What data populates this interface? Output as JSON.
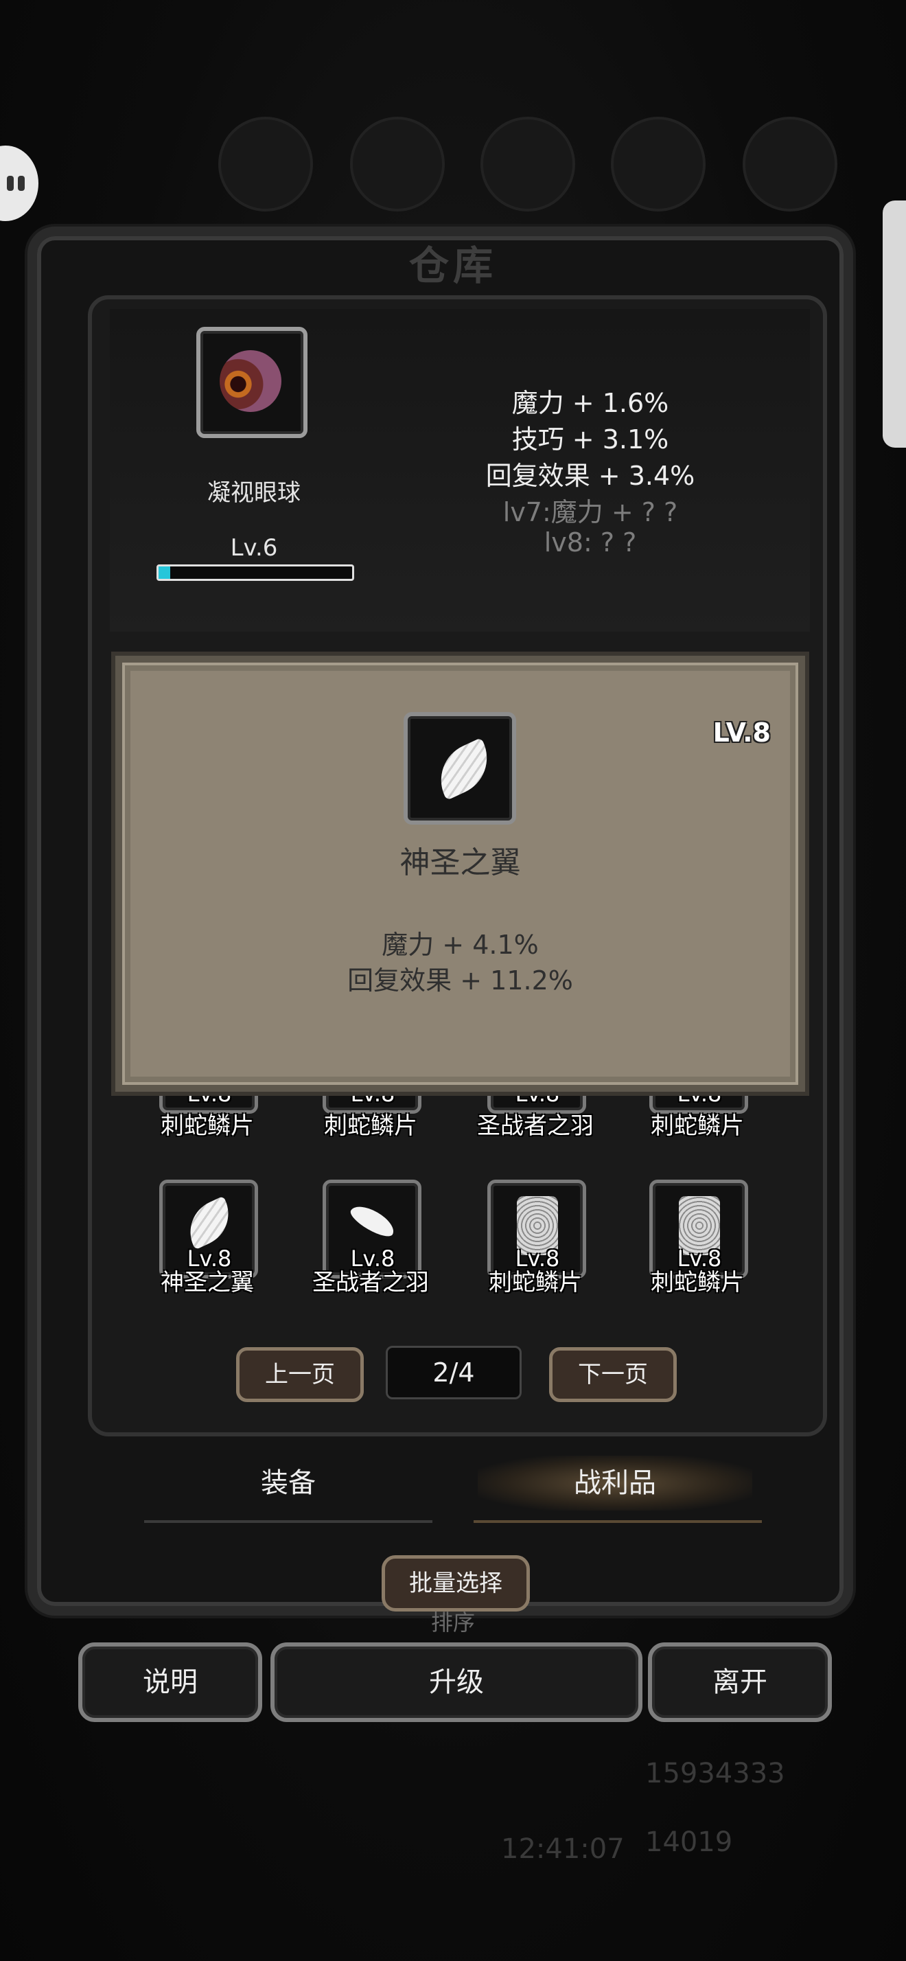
{
  "title": "仓库",
  "selected_item": {
    "name": "凝视眼球",
    "level": "Lv.6",
    "progress": 0.06,
    "stats": [
      "魔力 + 1.6%",
      "技巧 + 3.1%",
      "回复效果 + 3.4%"
    ],
    "locked_stats": [
      "lv7:魔力 + ? ?",
      "lv8: ? ?"
    ]
  },
  "popup": {
    "level": "LV.8",
    "name": "神圣之翼",
    "stats": [
      "魔力 + 4.1%",
      "回复效果 + 11.2%"
    ]
  },
  "grid": {
    "row1": [
      {
        "level": "Lv.8",
        "name": "刺蛇鳞片"
      },
      {
        "level": "Lv.8",
        "name": "刺蛇鳞片"
      },
      {
        "level": "Lv.8",
        "name": "圣战者之羽"
      },
      {
        "level": "Lv.8",
        "name": "刺蛇鳞片"
      }
    ],
    "row2": [
      {
        "level": "Lv.8",
        "name": "神圣之翼",
        "icon": "wing-icon"
      },
      {
        "level": "Lv.8",
        "name": "圣战者之羽",
        "icon": "feather-icon"
      },
      {
        "level": "Lv.8",
        "name": "刺蛇鳞片",
        "icon": "scale-icon"
      },
      {
        "level": "Lv.8",
        "name": "刺蛇鳞片",
        "icon": "scale-icon"
      }
    ]
  },
  "pagination": {
    "prev": "上一页",
    "indicator": "2/4",
    "next": "下一页"
  },
  "tabs": {
    "equip": "装备",
    "loot": "战利品",
    "active": "loot"
  },
  "batch_select": "批量选择",
  "sort": "排序",
  "buttons": {
    "help": "说明",
    "upgrade": "升级",
    "leave": "离开"
  },
  "background_hud": {
    "coins": "15934333",
    "gems": "14019",
    "time": "12:41:07"
  },
  "colors": {
    "popup_bg": "#8e8474",
    "progress_fill": "#26c6da",
    "button_brown": "#3a2e26"
  }
}
